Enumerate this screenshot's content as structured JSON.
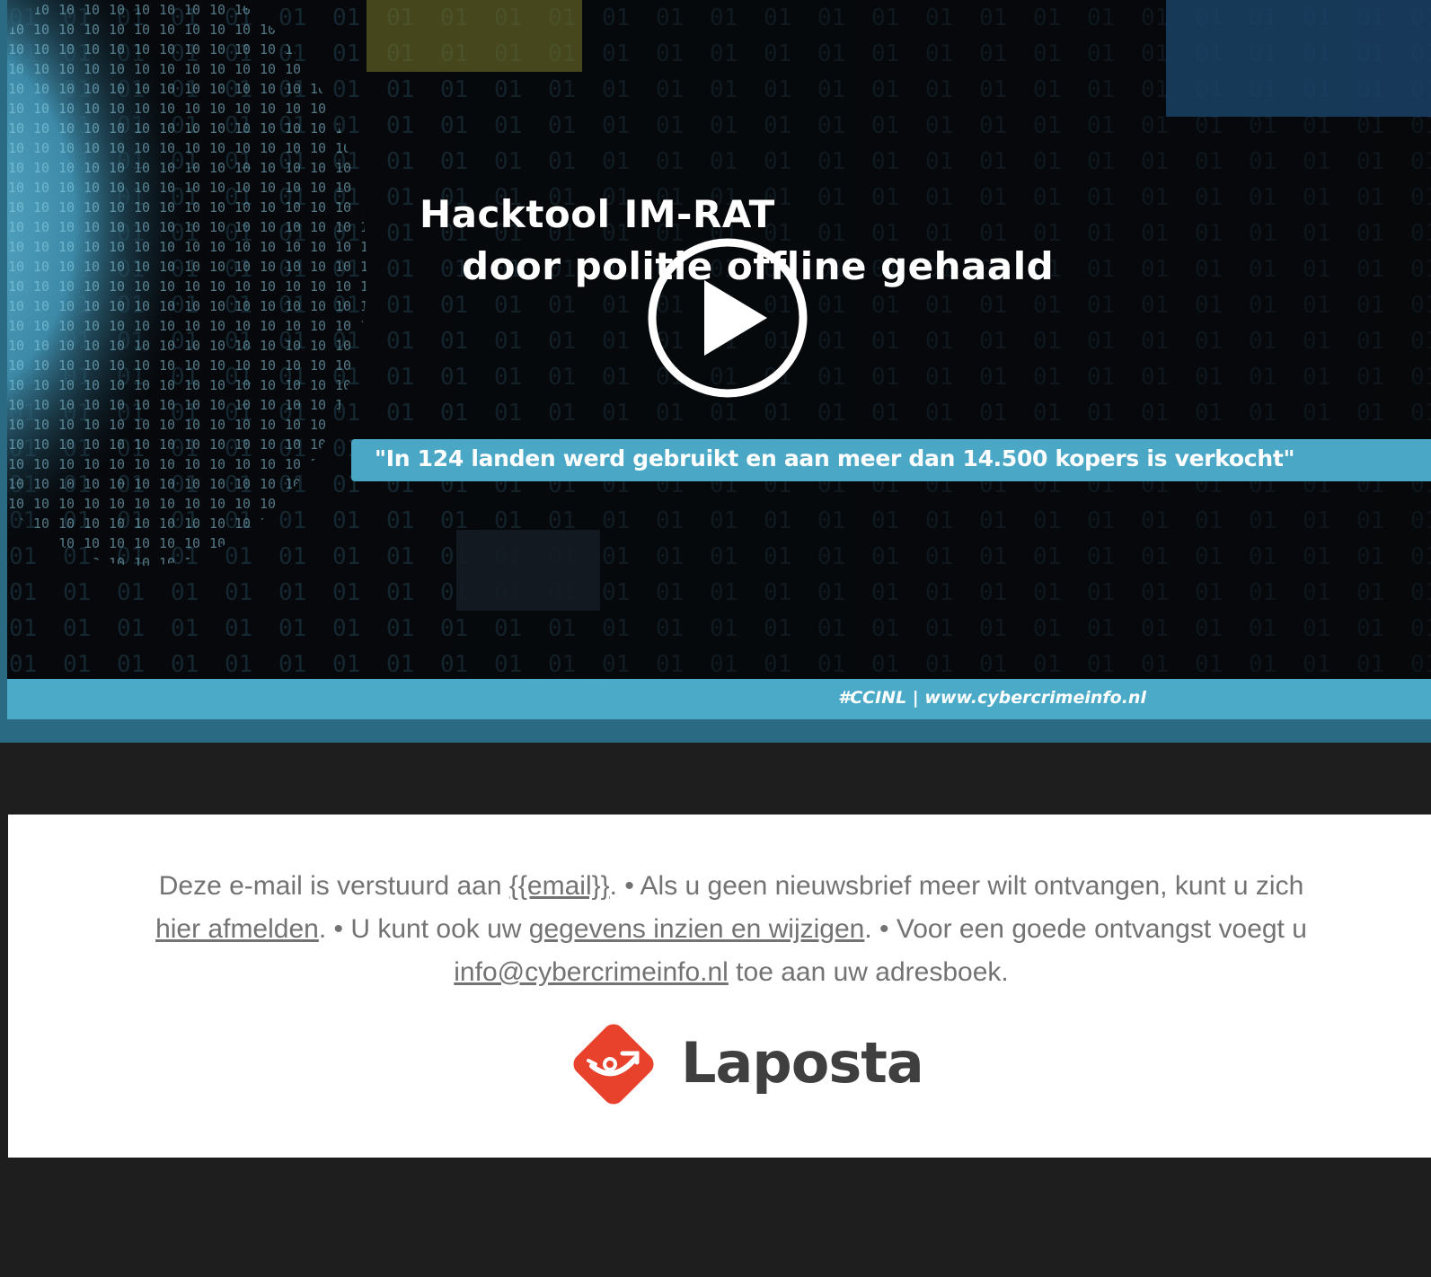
{
  "video": {
    "headline_line1": "Hacktool IM-RAT",
    "headline_line2": "door politie offline gehaald",
    "quote": "\"In 124 landen werd gebruikt en aan meer dan 14.500 kopers is verkocht\"",
    "footer": "#CCINL | www.cybercrimeinfo.nl",
    "play_icon": "play-icon",
    "colors": {
      "accent": "#4aa7c6",
      "card_border": "#2a6a82"
    }
  },
  "notice": {
    "part1": "Deze e-mail is verstuurd aan ",
    "email_link": "{{email}}",
    "part2": ". • Als u geen nieuwsbrief meer wilt ontvangen, kunt u zich ",
    "unsubscribe_link": "hier afmelden",
    "part3": ". • U kunt ook uw ",
    "profile_link": "gegevens inzien en wijzigen",
    "part4": ". • Voor een goede ontvangst voegt u ",
    "address_link": "info@cybercrimeinfo.nl",
    "part5": " toe aan uw adresboek."
  },
  "brand": {
    "name": "Laposta",
    "icon": "post-horn-icon",
    "color": "#e8412c"
  },
  "colors": {
    "page_background": "#1e1e1e",
    "notice_text": "#737373"
  }
}
